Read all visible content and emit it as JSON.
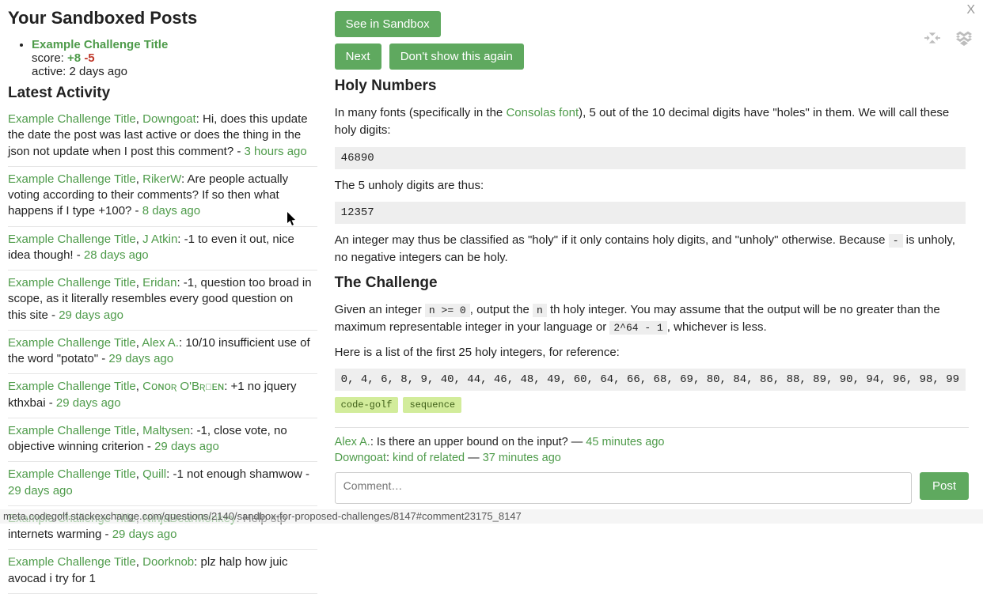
{
  "left": {
    "posts_heading": "Your Sandboxed Posts",
    "post": {
      "title": "Example Challenge Title",
      "score_label": "score:",
      "score_pos": "+8",
      "score_neg": "-5",
      "active_line": "active: 2 days ago"
    },
    "activity_heading": "Latest Activity",
    "activities": [
      {
        "title": "Example Challenge Title",
        "user": "Downgoat",
        "text": ": Hi, does this update the date the post was last active or does the thing in the json not update when I post this comment? - ",
        "time": "3 hours ago"
      },
      {
        "title": "Example Challenge Title",
        "user": "RikerW",
        "text": ": Are people actually voting according to their comments? If so then what happens if I type +100? - ",
        "time": "8 days ago"
      },
      {
        "title": "Example Challenge Title",
        "user": "J Atkin",
        "text": ": -1 to even it out, nice idea though! - ",
        "time": "28 days ago"
      },
      {
        "title": "Example Challenge Title",
        "user": "Eridan",
        "text": ": -1, question too broad in scope, as it literally resembles every good question on this site - ",
        "time": "29 days ago"
      },
      {
        "title": "Example Challenge Title",
        "user": "Alex A.",
        "text": ": 10/10 insufficient use of the word \"potato\" - ",
        "time": "29 days ago"
      },
      {
        "title": "Example Challenge Title",
        "user": "Cᴏɴᴏʀ O'Bʀɪᴇɴ",
        "text": ": +1 no jquery kthxbai - ",
        "time": "29 days ago"
      },
      {
        "title": "Example Challenge Title",
        "user": "Maltysen",
        "text": ": -1, close vote, no objective winning criterion - ",
        "time": "29 days ago"
      },
      {
        "title": "Example Challenge Title",
        "user": "Quill",
        "text": ": -1 not enough shamwow - ",
        "time": "29 days ago"
      },
      {
        "title": "Example Challenge Title",
        "user": "NinjaBearMonkey",
        "text": ": Help stp internets warming - ",
        "time": "29 days ago"
      },
      {
        "title": "Example Challenge Title",
        "user": "Doorknob",
        "text": ": plz halp how juic avocad i try for 1",
        "time": ""
      }
    ]
  },
  "right": {
    "buttons": {
      "see": "See in Sandbox",
      "next": "Next",
      "dont": "Don't show this again"
    },
    "close": "X",
    "post": {
      "title": "Holy Numbers",
      "p1a": "In many fonts (specifically in the ",
      "p1link": "Consolas font",
      "p1b": "), 5 out of the 10 decimal digits have \"holes\" in them. We will call these holy digits:",
      "code1": "46890",
      "p2": "The 5 unholy digits are thus:",
      "code2": "12357",
      "p3a": "An integer may thus be classified as \"holy\" if it only contains holy digits, and \"unholy\" otherwise. Because ",
      "code_minus": "-",
      "p3b": " is unholy, no negative integers can be holy.",
      "h_challenge": "The Challenge",
      "p4a": "Given an integer ",
      "code_nge0": "n >= 0",
      "p4b": ", output the ",
      "code_n": "n",
      "p4c": " th holy integer. You may assume that the output will be no greater than the maximum representable integer in your language or ",
      "code_264": "2^64 - 1",
      "p4d": ", whichever is less.",
      "p5": "Here is a list of the first 25 holy integers, for reference:",
      "code3": "0, 4, 6, 8, 9, 40, 44, 46, 48, 49, 60, 64, 66, 68, 69, 80, 84, 86, 88, 89, 90, 94, 96, 98, 99",
      "tags": [
        "code-golf",
        "sequence"
      ]
    },
    "comments": [
      {
        "user": "Alex A.",
        "text": ": Is there an upper bound on the input? — ",
        "time": "45 minutes ago"
      },
      {
        "user": "Downgoat",
        "text": ": ",
        "link": "kind of related",
        "post": " — ",
        "time": "37 minutes ago"
      }
    ],
    "comment_placeholder": "Comment…",
    "post_btn": "Post"
  },
  "statusbar": "meta.codegolf.stackexchange.com/questions/2140/sandbox-for-proposed-challenges/8147#comment23175_8147"
}
